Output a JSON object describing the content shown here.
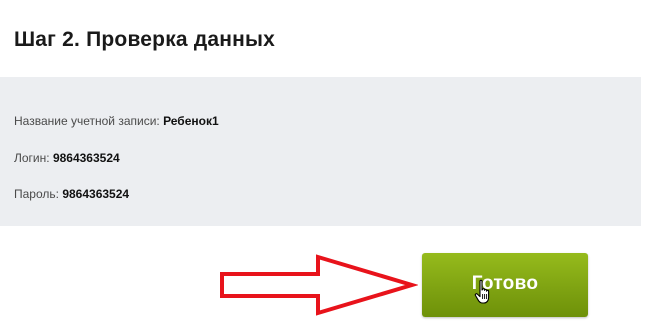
{
  "step": {
    "title": "Шаг 2. Проверка данных"
  },
  "summary": {
    "account_label": "Название учетной записи:",
    "account_value": "Ребенок1",
    "login_label": "Логин:",
    "login_value": "9864363524",
    "password_label": "Пароль:",
    "password_value": "9864363524"
  },
  "actions": {
    "done_label": "Готово"
  },
  "colors": {
    "panel_background": "#eceef1",
    "button_green": "#7fa312",
    "arrow_red": "#e8131b"
  },
  "icons": {
    "arrow": "right-arrow-icon",
    "cursor": "hand-pointer-icon"
  }
}
